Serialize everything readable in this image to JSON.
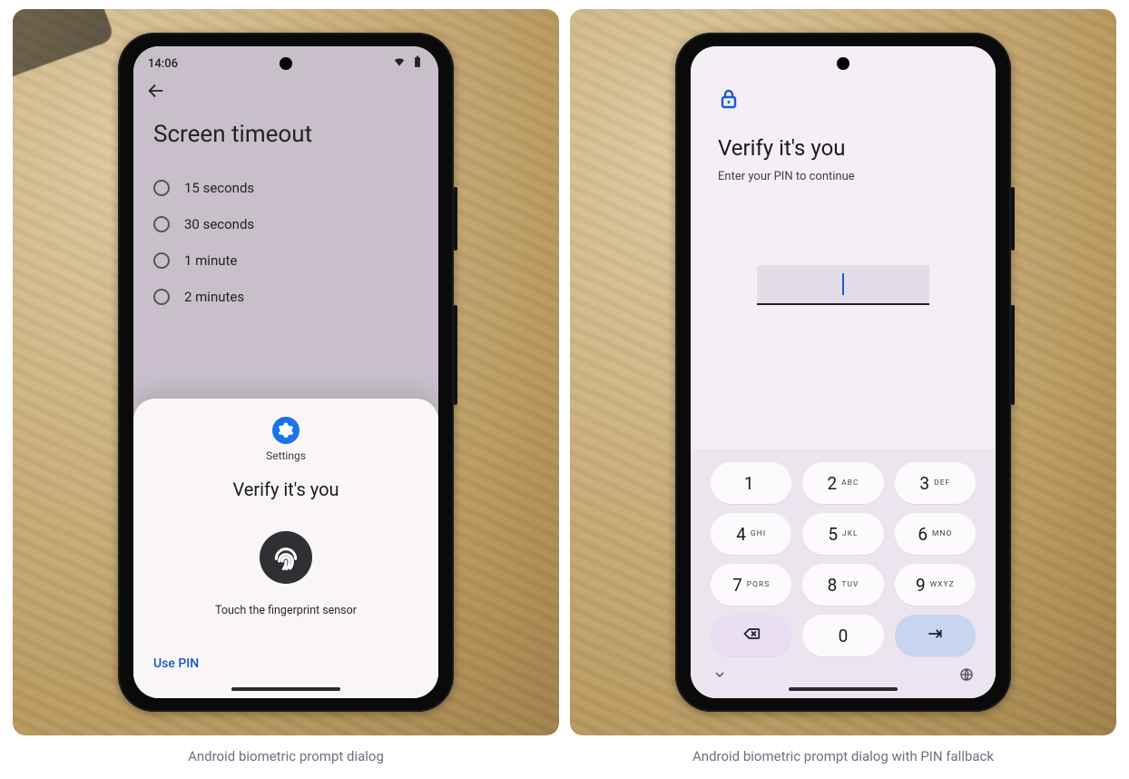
{
  "captions": {
    "left": "Android biometric prompt dialog",
    "right": "Android biometric prompt dialog with PIN fallback"
  },
  "left": {
    "status_time": "14:06",
    "bg_title": "Screen timeout",
    "options": [
      "15 seconds",
      "30 seconds",
      "1 minute",
      "2 minutes"
    ],
    "sheet": {
      "app_label": "Settings",
      "title": "Verify it's you",
      "hint": "Touch the fingerprint sensor",
      "use_pin": "Use PIN"
    }
  },
  "right": {
    "title": "Verify it's you",
    "subtitle": "Enter your PIN to continue",
    "keys": [
      {
        "d": "1",
        "l": ""
      },
      {
        "d": "2",
        "l": "ABC"
      },
      {
        "d": "3",
        "l": "DEF"
      },
      {
        "d": "4",
        "l": "GHI"
      },
      {
        "d": "5",
        "l": "JKL"
      },
      {
        "d": "6",
        "l": "MNO"
      },
      {
        "d": "7",
        "l": "PQRS"
      },
      {
        "d": "8",
        "l": "TUV"
      },
      {
        "d": "9",
        "l": "WXYZ"
      }
    ],
    "zero": "0"
  }
}
